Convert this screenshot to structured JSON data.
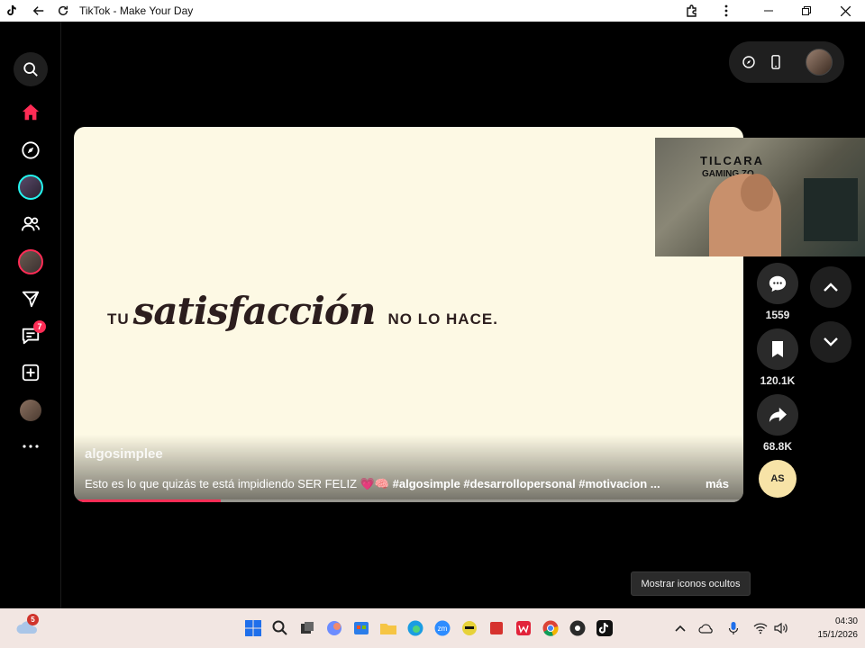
{
  "window": {
    "title": "TikTok - Make Your Day"
  },
  "sidebar": {
    "items": [
      {
        "name": "search-icon"
      },
      {
        "name": "home-icon",
        "active": true
      },
      {
        "name": "explore-icon"
      },
      {
        "name": "following-avatar"
      },
      {
        "name": "friends-icon"
      },
      {
        "name": "live-avatar"
      },
      {
        "name": "send-icon"
      },
      {
        "name": "messages-icon",
        "badge": "7"
      },
      {
        "name": "upload-icon"
      },
      {
        "name": "profile-avatar"
      },
      {
        "name": "more-icon"
      }
    ]
  },
  "video": {
    "headline_prefix": "TU",
    "headline_main": "satisfacción",
    "headline_suffix": "NO LO HACE.",
    "username": "algosimplee",
    "caption_text": "Esto es lo que quizás te está impidiendo SER FELIZ",
    "caption_emoji": "💗🧠",
    "caption_tags": "#algosimple #desarrollopersonal #motivacion ...",
    "more_label": "más",
    "progress": 0.22
  },
  "webcam": {
    "line1": "TILCARA",
    "line2": "GAMING ZO"
  },
  "actions": {
    "comments": "1559",
    "saves": "120.1K",
    "shares": "68.8K",
    "music_label": "AS"
  },
  "tooltip": "Mostrar iconos ocultos",
  "taskbar": {
    "weather_badge": "5",
    "time": "04:30",
    "date": "15/1/2026"
  },
  "colors": {
    "accent": "#fe2c55",
    "cyan": "#25f4ee",
    "video_bg": "#fdf9e4"
  }
}
